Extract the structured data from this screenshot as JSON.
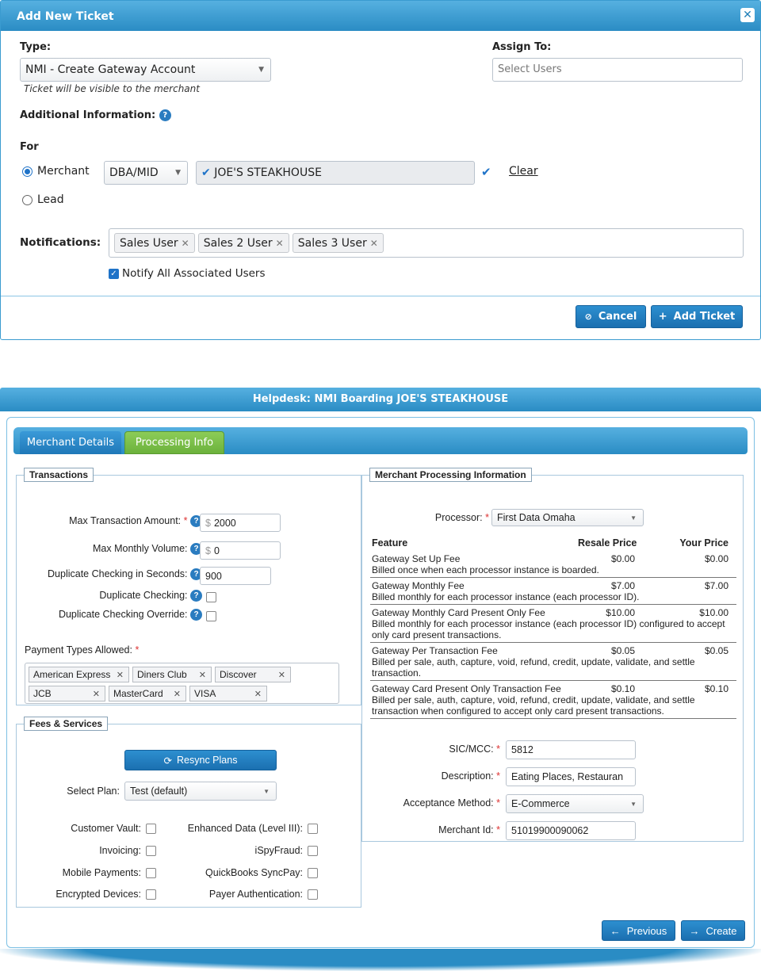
{
  "ticket_modal": {
    "title": "Add New Ticket",
    "type_label": "Type:",
    "type_value": "NMI - Create Gateway Account",
    "visibility_note": "Ticket will be visible to the merchant",
    "assign_label": "Assign To:",
    "assign_placeholder": "Select Users",
    "additional_info_label": "Additional Information:",
    "for_label": "For",
    "merchant_label": "Merchant",
    "lead_label": "Lead",
    "lookup_value": "DBA/MID",
    "merchant_value": "JOE'S STEAKHOUSE",
    "clear_label": "Clear",
    "notifications_label": "Notifications:",
    "notification_tags": [
      "Sales User",
      "Sales 2 User",
      "Sales 3 User"
    ],
    "notify_all_label": "Notify All Associated Users",
    "cancel_label": "Cancel",
    "add_label": "Add Ticket"
  },
  "helpdesk_modal": {
    "title": "Helpdesk: NMI Boarding JOE'S STEAKHOUSE",
    "tabs": [
      "Merchant Details",
      "Processing Info"
    ],
    "transactions": {
      "legend": "Transactions",
      "max_txn_label": "Max Transaction Amount:",
      "max_txn_value": "2000",
      "max_monthly_label": "Max Monthly Volume:",
      "max_monthly_value": "0",
      "currency": "$",
      "dup_seconds_label": "Duplicate Checking in Seconds:",
      "dup_seconds_value": "900",
      "dup_check_label": "Duplicate Checking:",
      "dup_override_label": "Duplicate Checking Override:",
      "payment_types_label": "Payment Types Allowed:",
      "payment_types": [
        "American Express",
        "Diners Club",
        "Discover",
        "JCB",
        "MasterCard",
        "VISA"
      ]
    },
    "fees": {
      "legend": "Fees & Services",
      "resync_label": "Resync Plans",
      "select_plan_label": "Select Plan:",
      "select_plan_value": "Test (default)",
      "options": [
        "Customer Vault:",
        "Enhanced Data (Level III):",
        "Invoicing:",
        "iSpyFraud:",
        "Mobile Payments:",
        "QuickBooks SyncPay:",
        "Encrypted Devices:",
        "Payer Authentication:"
      ]
    },
    "processing": {
      "legend": "Merchant Processing Information",
      "processor_label": "Processor:",
      "processor_value": "First Data Omaha",
      "headers": [
        "Feature",
        "Resale Price",
        "Your Price"
      ],
      "rows": [
        {
          "name": "Gateway Set Up Fee",
          "resale": "$0.00",
          "yours": "$0.00",
          "desc": "Billed once when each processor instance is boarded."
        },
        {
          "name": "Gateway Monthly Fee",
          "resale": "$7.00",
          "yours": "$7.00",
          "desc": "Billed monthly for each processor instance (each processor ID)."
        },
        {
          "name": "Gateway Monthly Card Present Only Fee",
          "resale": "$10.00",
          "yours": "$10.00",
          "desc": "Billed monthly for each processor instance (each processor ID) configured to accept only card present transactions."
        },
        {
          "name": "Gateway Per Transaction Fee",
          "resale": "$0.05",
          "yours": "$0.05",
          "desc": "Billed per sale, auth, capture, void, refund, credit, update, validate, and settle transaction."
        },
        {
          "name": "Gateway Card Present Only Transaction Fee",
          "resale": "$0.10",
          "yours": "$0.10",
          "desc": "Billed per sale, auth, capture, void, refund, credit, update, validate, and settle transaction when configured to accept only card present transactions."
        }
      ],
      "sic_label": "SIC/MCC:",
      "sic_value": "5812",
      "description_label": "Description:",
      "description_value": "Eating Places, Restauran",
      "acceptance_label": "Acceptance Method:",
      "acceptance_value": "E-Commerce",
      "merchant_id_label": "Merchant Id:",
      "merchant_id_value": "51019900090062"
    },
    "previous_label": "Previous",
    "create_label": "Create"
  },
  "colors": {
    "header_blue": "#2a8cc4",
    "tab_green": "#6cb23c",
    "required": "#d33"
  }
}
